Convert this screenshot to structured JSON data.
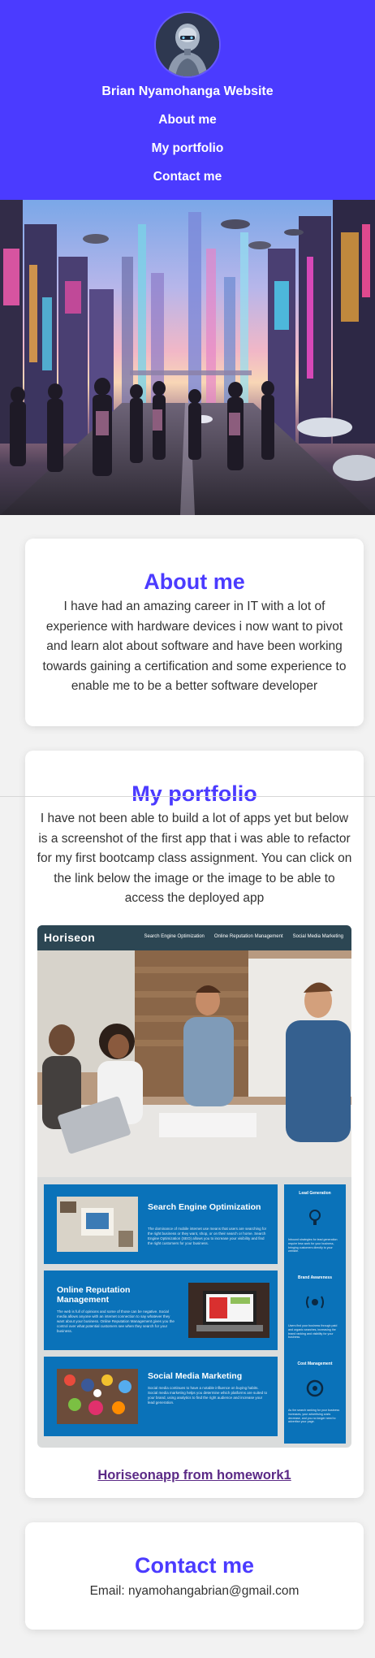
{
  "header": {
    "title": "Brian Nyamohanga Website",
    "nav": [
      "About me",
      "My portfolio",
      "Contact me"
    ],
    "background_color": "#4b3bff",
    "avatar": "robot-avatar"
  },
  "hero": {
    "image": "futuristic-city-illustration"
  },
  "about": {
    "heading": "About me",
    "text": "I have had an amazing career in IT with a lot of experience with hardware devices i now want to pivot and learn alot about software and have been working towards gaining a certification and some experience to enable me to be a better software developer"
  },
  "portfolio": {
    "heading": "My portfolio",
    "text": "I have not been able to build a lot of apps yet but below is a screenshot of the first app that i was able to refactor for my first bootcamp class assignment. You can click on the link below the image or the image to be able to access the deployed app",
    "link_text": "Horiseonapp from homework1",
    "screenshot": {
      "brand": "Horiseon",
      "nav": [
        "Search Engine Optimization",
        "Online Reputation Management",
        "Social Media Marketing"
      ],
      "articles": [
        {
          "title": "Search Engine Optimization",
          "text": "The dominance of mobile internet use means that users are searching for the right business or they want, shop, or on their search or home. Search Engine Optimization (SEO) allows you to increase your visibility and find the right customers for your business."
        },
        {
          "title": "Online Reputation Management",
          "text": "The web is full of opinions and some of those can be negative. Social media allows anyone with an internet connection to say whatever they want about your business. Online Reputation Management gives you the control over what potential customers see when they search for your business."
        },
        {
          "title": "Social Media Marketing",
          "text": "Social media continues to have a notable influence on buying habits. Social media marketing helps you determine which platforms are suited to your brand, using analytics to find the right audience and increase your lead generation."
        }
      ],
      "benefits": [
        {
          "title": "Lead Generation",
          "text": "Inbound strategies for lead generation require less work for your business, bringing customers directly to your website."
        },
        {
          "title": "Brand Awareness",
          "text": "Users find your business through paid and organic searches, increasing the brand ranking and visibility for your business."
        },
        {
          "title": "Cost Management",
          "text": "As the search ranking for your business increases, your advertising costs decrease, and you no longer need to advertise your page."
        }
      ]
    }
  },
  "contact": {
    "heading": "Contact me",
    "text": "Email: nyamohangabrian@gmail.com"
  }
}
